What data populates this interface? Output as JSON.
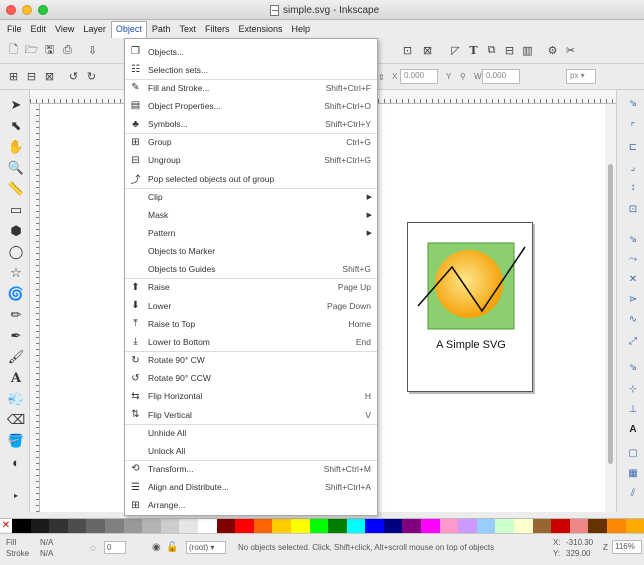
{
  "window": {
    "title": "simple.svg - Inkscape"
  },
  "menubar": [
    "File",
    "Edit",
    "View",
    "Layer",
    "Object",
    "Path",
    "Text",
    "Filters",
    "Extensions",
    "Help"
  ],
  "active_menu": "Object",
  "dropdown": [
    {
      "label": "Objects...",
      "shortcut": "",
      "icon": "objects-icon",
      "glyph": "❐"
    },
    {
      "label": "Selection sets...",
      "shortcut": "",
      "icon": "selection-sets-icon",
      "glyph": "☷"
    },
    {
      "label": "Fill and Stroke...",
      "shortcut": "Shift+Ctrl+F",
      "icon": "fill-stroke-icon",
      "glyph": "✎"
    },
    {
      "label": "Object Properties...",
      "shortcut": "Shift+Ctrl+O",
      "icon": "object-properties-icon",
      "glyph": "▤"
    },
    {
      "label": "Symbols...",
      "shortcut": "Shift+Ctrl+Y",
      "icon": "symbols-icon",
      "glyph": "♣"
    },
    {
      "label": "Group",
      "shortcut": "Ctrl+G",
      "icon": "group-icon",
      "glyph": "⊞"
    },
    {
      "label": "Ungroup",
      "shortcut": "Shift+Ctrl+G",
      "icon": "ungroup-icon",
      "glyph": "⊟"
    },
    {
      "label": "Pop selected objects out of group",
      "shortcut": "",
      "icon": "pop-out-icon",
      "glyph": "⤴"
    },
    {
      "label": "Clip",
      "shortcut": "",
      "icon": "",
      "glyph": "",
      "submenu": true
    },
    {
      "label": "Mask",
      "shortcut": "",
      "icon": "",
      "glyph": "",
      "submenu": true
    },
    {
      "label": "Pattern",
      "shortcut": "",
      "icon": "",
      "glyph": "",
      "submenu": true
    },
    {
      "label": "Objects to Marker",
      "shortcut": "",
      "icon": "",
      "glyph": ""
    },
    {
      "label": "Objects to Guides",
      "shortcut": "Shift+G",
      "icon": "",
      "glyph": ""
    },
    {
      "label": "Raise",
      "shortcut": "Page Up",
      "icon": "raise-icon",
      "glyph": "⬆"
    },
    {
      "label": "Lower",
      "shortcut": "Page Down",
      "icon": "lower-icon",
      "glyph": "⬇"
    },
    {
      "label": "Raise to Top",
      "shortcut": "Home",
      "icon": "raise-top-icon",
      "glyph": "⤒"
    },
    {
      "label": "Lower to Bottom",
      "shortcut": "End",
      "icon": "lower-bottom-icon",
      "glyph": "⤓"
    },
    {
      "label": "Rotate 90° CW",
      "shortcut": "",
      "icon": "rotate-cw-icon",
      "glyph": "↻"
    },
    {
      "label": "Rotate 90° CCW",
      "shortcut": "",
      "icon": "rotate-ccw-icon",
      "glyph": "↺"
    },
    {
      "label": "Flip Horizontal",
      "shortcut": "H",
      "icon": "flip-horizontal-icon",
      "glyph": "⇆"
    },
    {
      "label": "Flip Vertical",
      "shortcut": "V",
      "icon": "flip-vertical-icon",
      "glyph": "⇅"
    },
    {
      "label": "Unhide All",
      "shortcut": "",
      "icon": "",
      "glyph": ""
    },
    {
      "label": "Unlock All",
      "shortcut": "",
      "icon": "",
      "glyph": ""
    },
    {
      "label": "Transform...",
      "shortcut": "Shift+Ctrl+M",
      "icon": "transform-icon",
      "glyph": "⟲"
    },
    {
      "label": "Align and Distribute...",
      "shortcut": "Shift+Ctrl+A",
      "icon": "align-icon",
      "glyph": "☰"
    },
    {
      "label": "Arrange...",
      "shortcut": "",
      "icon": "arrange-icon",
      "glyph": "⊞"
    }
  ],
  "toolbar2": {
    "x_label": "X",
    "x_value": "0.000",
    "y_label": "Y",
    "y_value": "0.000",
    "w_label": "W",
    "w_value": "0.000",
    "unit": "px"
  },
  "canvas": {
    "drawing_label": "A Simple SVG",
    "colors": {
      "green": "#8ccf6e",
      "orange": "#f5a10a",
      "yellow": "#fde78a"
    }
  },
  "statusbar": {
    "fill_label": "Fill",
    "fill_value": "N/A",
    "stroke_label": "Stroke",
    "stroke_value": "N/A",
    "opacity_value": "0",
    "layer": "(root)",
    "message": "No objects selected. Click, Shift+click, Alt+scroll mouse on top of objects",
    "x_label": "X:",
    "x_value": "-310.30",
    "y_label": "Y:",
    "y_value": "329.00",
    "z_label": "Z",
    "zoom": "116%"
  },
  "palette": [
    "#000000",
    "#1a1a1a",
    "#333333",
    "#4d4d4d",
    "#666666",
    "#808080",
    "#999999",
    "#b3b3b3",
    "#cccccc",
    "#e6e6e6",
    "#ffffff",
    "#800000",
    "#ff0000",
    "#ff6600",
    "#ffcc00",
    "#ffff00",
    "#00ff00",
    "#008000",
    "#00ffff",
    "#0000ff",
    "#000080",
    "#800080",
    "#ff00ff",
    "#ff99cc",
    "#cc99ff",
    "#99ccff",
    "#ccffcc",
    "#ffffcc",
    "#996633",
    "#cc0000",
    "#ee8888",
    "#663300",
    "#ff8800",
    "#ffaa00"
  ]
}
